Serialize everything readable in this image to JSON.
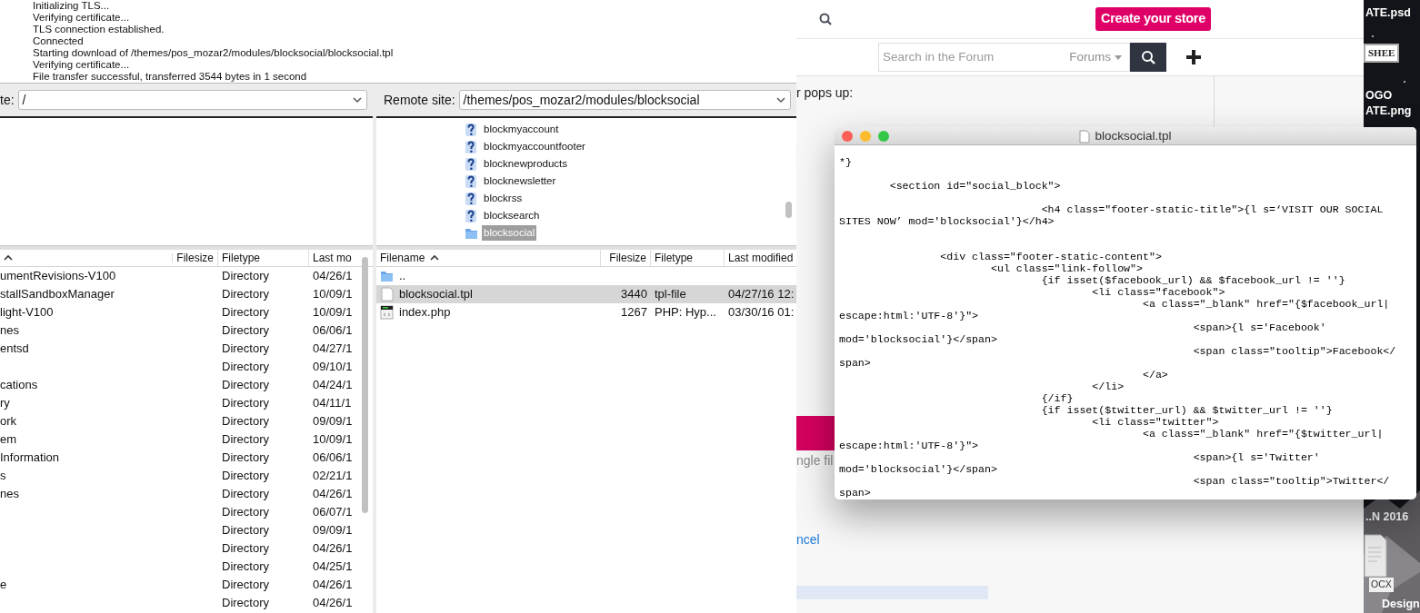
{
  "filezilla": {
    "log": [
      "Initializing TLS...",
      "Verifying certificate...",
      "TLS connection established.",
      "Connected",
      "Starting download of /themes/pos_mozar2/modules/blocksocial/blocksocial.tpl",
      "Verifying certificate...",
      "File transfer successful, transferred 3544 bytes in 1 second"
    ],
    "local": {
      "site_label": "te:",
      "path": "/",
      "columns": [
        {
          "sorted": true
        },
        {
          "label": "Filesize",
          "sorted": false
        },
        {
          "label": "Filetype",
          "sorted": false
        },
        {
          "label": "Last mo",
          "sorted": false
        }
      ],
      "files": [
        {
          "name": "umentRevisions-V100",
          "type": "Directory",
          "modified": "04/26/1",
          "selected": false
        },
        {
          "name": "stallSandboxManager",
          "type": "Directory",
          "modified": "10/09/1",
          "selected": false
        },
        {
          "name": "light-V100",
          "type": "Directory",
          "modified": "10/09/1",
          "selected": false
        },
        {
          "name": "nes",
          "type": "Directory",
          "modified": "06/06/1",
          "selected": false
        },
        {
          "name": "entsd",
          "type": "Directory",
          "modified": "04/27/1",
          "selected": false
        },
        {
          "type": "Directory",
          "modified": "09/10/1",
          "selected": false
        },
        {
          "name": "cations",
          "type": "Directory",
          "modified": "04/24/1",
          "selected": false
        },
        {
          "name": "ry",
          "type": "Directory",
          "modified": "04/11/1",
          "selected": false
        },
        {
          "name": "ork",
          "type": "Directory",
          "modified": "09/09/1",
          "selected": false
        },
        {
          "name": "em",
          "type": "Directory",
          "modified": "10/09/1",
          "selected": false
        },
        {
          "name": "Information",
          "type": "Directory",
          "modified": "06/06/1",
          "selected": false
        },
        {
          "name": "s",
          "type": "Directory",
          "modified": "02/21/1",
          "selected": false
        },
        {
          "name": "nes",
          "type": "Directory",
          "modified": "04/26/1",
          "selected": false
        },
        {
          "type": "Directory",
          "modified": "06/07/1",
          "selected": false
        },
        {
          "type": "Directory",
          "modified": "09/09/1",
          "selected": false
        },
        {
          "type": "Directory",
          "modified": "04/26/1",
          "selected": false
        },
        {
          "type": "Directory",
          "modified": "04/25/1",
          "selected": false
        },
        {
          "name": "e",
          "type": "Directory",
          "modified": "04/26/1",
          "selected": false
        },
        {
          "type": "Directory",
          "modified": "04/26/1",
          "selected": false
        }
      ]
    },
    "remote": {
      "site_label": "Remote site:",
      "path": "/themes/pos_mozar2/modules/blocksocial",
      "tree": [
        {
          "name": "blockmyaccount",
          "kind": "unknown",
          "selected": false
        },
        {
          "name": "blockmyaccountfooter",
          "kind": "unknown",
          "selected": false
        },
        {
          "name": "blocknewproducts",
          "kind": "unknown",
          "selected": false
        },
        {
          "name": "blocknewsletter",
          "kind": "unknown",
          "selected": false
        },
        {
          "name": "blockrss",
          "kind": "unknown",
          "selected": false
        },
        {
          "name": "blocksearch",
          "kind": "unknown",
          "selected": false
        },
        {
          "name": "blocksocial",
          "kind": "folder",
          "selected": true
        }
      ],
      "columns": [
        {
          "label": "Filename",
          "sorted": true
        },
        {
          "label": "Filesize",
          "sorted": false
        },
        {
          "label": "Filetype",
          "sorted": false
        },
        {
          "label": "Last modified",
          "sorted": false
        }
      ],
      "files": [
        {
          "name": "..",
          "kind": "folder",
          "selected": false
        },
        {
          "name": "blocksocial.tpl",
          "kind": "file",
          "size": "3440",
          "type": "tpl-file",
          "modified": "04/27/16 12:",
          "selected": true
        },
        {
          "name": "index.php",
          "kind": "php",
          "size": "1267",
          "type": "PHP: Hyp...",
          "modified": "03/30/16 01:",
          "selected": false
        }
      ]
    }
  },
  "browser": {
    "create_button": "Create your store",
    "search": {
      "placeholder": "Search in the Forum",
      "scope": "Forums"
    },
    "intro_text": "r pops up:",
    "hint_text": "ngle fil",
    "link": "ncel"
  },
  "editor": {
    "title": "blocksocial.tpl",
    "lines": [
      {
        "kind": "code",
        "text": "*}"
      },
      {
        "kind": "blank"
      },
      {
        "kind": "code",
        "text": "\t<section id=\"social_block\">"
      },
      {
        "kind": "blank"
      },
      {
        "kind": "code",
        "text": "\t\t\t\t<h4 class=\"footer-static-title\">{l s=‘VISIT OUR SOCIAL"
      },
      {
        "kind": "code",
        "text": "SITES NOW’ mod='blocksocial'}</h4>"
      },
      {
        "kind": "blank"
      },
      {
        "kind": "blank"
      },
      {
        "kind": "code",
        "text": "\t\t<div class=\"footer-static-content\">"
      },
      {
        "kind": "code",
        "text": "\t\t\t<ul class=\"link-follow\">"
      },
      {
        "kind": "code",
        "text": "\t\t\t\t{if isset($facebook_url) && $facebook_url != ''}"
      },
      {
        "kind": "code",
        "text": "\t\t\t\t\t<li class=\"facebook\">"
      },
      {
        "kind": "code",
        "text": "\t\t\t\t\t\t<a class=\"_blank\" href=\"{$facebook_url|"
      },
      {
        "kind": "code",
        "text": "escape:html:'UTF-8'}\">"
      },
      {
        "kind": "code",
        "text": "\t\t\t\t\t\t\t<span>{l s='Facebook'"
      },
      {
        "kind": "code",
        "text": "mod='blocksocial'}</span>"
      },
      {
        "kind": "code",
        "text": "\t\t\t\t\t\t\t<span class=\"tooltip\">Facebook</"
      },
      {
        "kind": "code",
        "text": "span>"
      },
      {
        "kind": "code",
        "text": "\t\t\t\t\t\t</a>"
      },
      {
        "kind": "code",
        "text": "\t\t\t\t\t</li>"
      },
      {
        "kind": "code",
        "text": "\t\t\t\t{/if}"
      },
      {
        "kind": "code",
        "text": "\t\t\t\t{if isset($twitter_url) && $twitter_url != ''}"
      },
      {
        "kind": "code",
        "text": "\t\t\t\t\t<li class=\"twitter\">"
      },
      {
        "kind": "code",
        "text": "\t\t\t\t\t\t<a class=\"_blank\" href=\"{$twitter_url|"
      },
      {
        "kind": "code",
        "text": "escape:html:'UTF-8'}\">"
      },
      {
        "kind": "code",
        "text": "\t\t\t\t\t\t\t<span>{l s='Twitter'"
      },
      {
        "kind": "code",
        "text": "mod='blocksocial'}</span>"
      },
      {
        "kind": "code",
        "text": "\t\t\t\t\t\t\t<span class=\"tooltip\">Twitter</"
      },
      {
        "kind": "code",
        "text": "span>"
      }
    ]
  },
  "desktop": {
    "items": [
      {
        "label": "ATE.psd",
        "kind": "label"
      },
      {
        "label": "SHEE",
        "kind": "thumb"
      },
      {
        "label": "OGO",
        "kind": "label"
      },
      {
        "label": "ATE.png",
        "kind": "label"
      },
      {
        "label": "..N 2016",
        "kind": "label"
      },
      {
        "label": "OCX",
        "kind": "doc"
      },
      {
        "label": "Design",
        "kind": "label"
      }
    ]
  }
}
